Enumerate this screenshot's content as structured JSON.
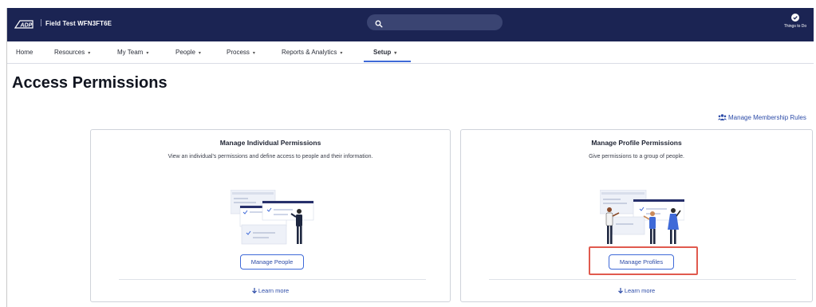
{
  "header": {
    "company_name": "Field Test WFN3FT6E",
    "search": {
      "placeholder": ""
    },
    "things_to_do_label": "Things to Do"
  },
  "nav": {
    "items": [
      {
        "label": "Home"
      },
      {
        "label": "Resources"
      },
      {
        "label": "My Team"
      },
      {
        "label": "People"
      },
      {
        "label": "Process"
      },
      {
        "label": "Reports & Analytics"
      },
      {
        "label": "Setup"
      }
    ],
    "active": "Setup"
  },
  "page": {
    "title": "Access Permissions",
    "membership_link": "Manage Membership Rules"
  },
  "cards": [
    {
      "title": "Manage Individual Permissions",
      "description": "View an individual's permissions and define access to people and their information.",
      "button": "Manage People",
      "learn_more": "Learn more"
    },
    {
      "title": "Manage Profile Permissions",
      "description": "Give permissions to a group of people.",
      "button": "Manage Profiles",
      "learn_more": "Learn more"
    }
  ],
  "colors": {
    "header_bg": "#1b2453",
    "accent": "#3f6ad8",
    "highlight": "#e05a4e"
  }
}
